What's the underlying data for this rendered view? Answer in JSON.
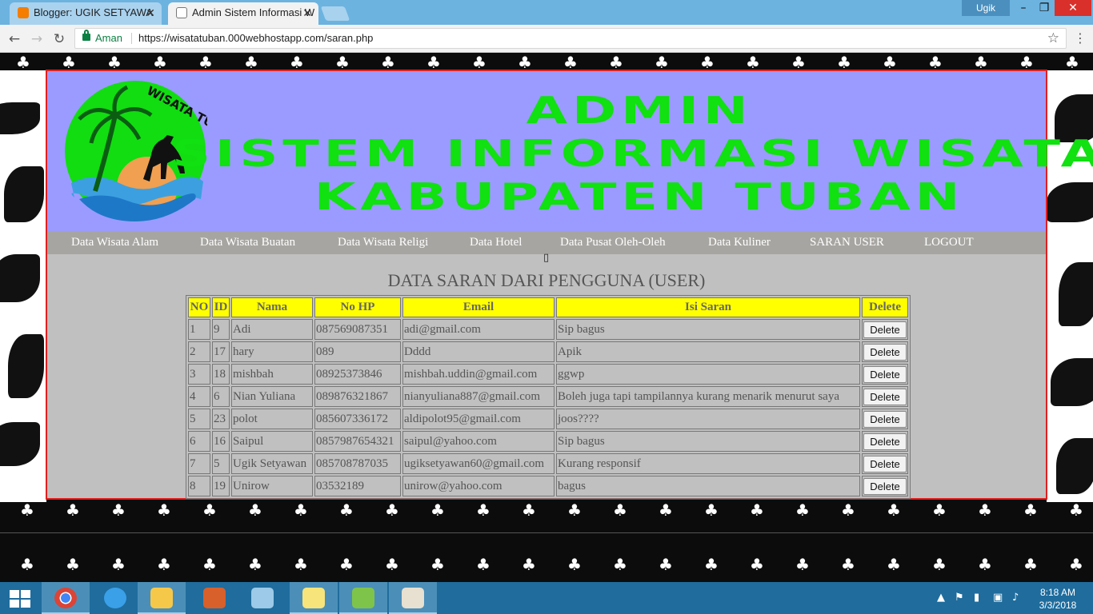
{
  "browser": {
    "tabs": [
      {
        "title": "Blogger: UGIK SETYAWA",
        "active": false,
        "icon": "blogger-icon"
      },
      {
        "title": "Admin Sistem Informasi W",
        "active": true,
        "icon": "page-icon"
      }
    ],
    "user_chip": "Ugik",
    "secure_label": "Aman",
    "url": "https://wisatatuban.000webhostapp.com/saran.php"
  },
  "header": {
    "logo_text": "WISATA TUBAN",
    "title_lines": [
      "ADMIN",
      "SISTEM INFORMASI WISATA",
      "KABUPATEN TUBAN"
    ]
  },
  "nav": {
    "items": [
      "Data Wisata Alam",
      "Data Wisata Buatan",
      "Data Wisata Religi",
      "Data Hotel",
      "Data Pusat Oleh-Oleh",
      "Data Kuliner",
      "SARAN USER",
      "LOGOUT"
    ]
  },
  "glyph": "▯",
  "main": {
    "heading": "DATA SARAN DARI PENGGUNA (USER)",
    "columns": [
      "NO",
      "ID",
      "Nama",
      "No HP",
      "Email",
      "Isi Saran",
      "Delete"
    ],
    "delete_label": "Delete",
    "rows": [
      [
        "1",
        "9",
        "Adi",
        "087569087351",
        "adi@gmail.com",
        "Sip bagus"
      ],
      [
        "2",
        "17",
        "hary",
        "089",
        "Dddd",
        "Apik"
      ],
      [
        "3",
        "18",
        "mishbah",
        "08925373846",
        "mishbah.uddin@gmail.com",
        "ggwp"
      ],
      [
        "4",
        "6",
        "Nian Yuliana",
        "089876321867",
        "nianyuliana887@gmail.com",
        "Boleh juga tapi tampilannya kurang menarik menurut saya"
      ],
      [
        "5",
        "23",
        "polot",
        "085607336172",
        "aldipolot95@gmail.com",
        "joos????"
      ],
      [
        "6",
        "16",
        "Saipul",
        "0857987654321",
        "saipul@yahoo.com",
        "Sip bagus"
      ],
      [
        "7",
        "5",
        "Ugik Setyawan",
        "085708787035",
        "ugiksetyawan60@gmail.com",
        "Kurang responsif"
      ],
      [
        "8",
        "19",
        "Unirow",
        "03532189",
        "unirow@yahoo.com",
        "bagus"
      ]
    ]
  },
  "taskbar": {
    "apps": [
      "chrome-icon",
      "internet-explorer-icon",
      "file-explorer-icon",
      "media-player-icon",
      "notepad-icon",
      "sticky-notes-icon",
      "android-studio-icon",
      "paint-icon"
    ],
    "time": "8:18 AM",
    "date": "3/3/2018"
  },
  "colors": {
    "banner": "#9b9bff",
    "title_green": "#11e011",
    "header_yellow": "#ffff00",
    "frame_border": "#e02020",
    "taskbar": "#1f6c9d"
  }
}
